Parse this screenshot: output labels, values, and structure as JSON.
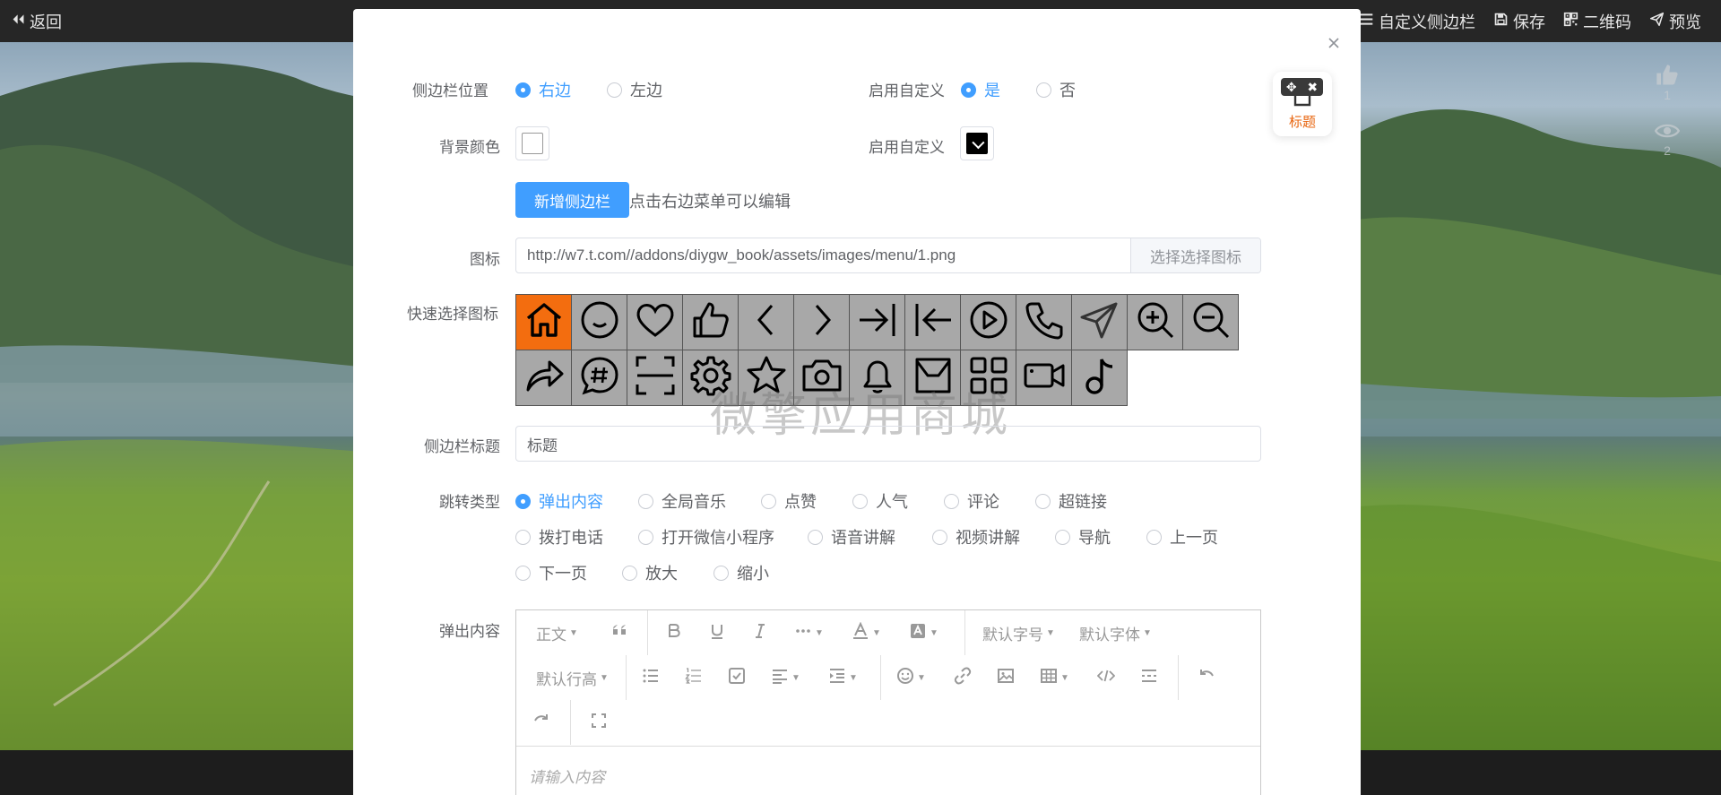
{
  "topbar": {
    "back_label": "返回",
    "actions": [
      {
        "icon": "list-icon",
        "label": "自定义侧边栏"
      },
      {
        "icon": "save-icon",
        "label": "保存"
      },
      {
        "icon": "qrcode-icon",
        "label": "二维码"
      },
      {
        "icon": "paper-plane-icon",
        "label": "预览"
      }
    ]
  },
  "background": {
    "stats": {
      "likes": "1",
      "views": "2"
    }
  },
  "modal": {
    "preview": {
      "label": "标题"
    },
    "sidebar_position": {
      "label": "侧边栏位置",
      "options": [
        "右边",
        "左边"
      ],
      "selected": "右边"
    },
    "enable_custom": {
      "label": "启用自定义",
      "options": [
        "是",
        "否"
      ],
      "selected": "是"
    },
    "bg_color": {
      "label": "背景颜色",
      "value": "#ffffff"
    },
    "enable_custom_color": {
      "label": "启用自定义",
      "value": "#000000"
    },
    "add_sidebar": {
      "button": "新增侧边栏",
      "hint": "点击右边菜单可以编辑"
    },
    "icon": {
      "label": "图标",
      "value": "http://w7.t.com//addons/diygw_book/assets/images/menu/1.png",
      "button": "选择选择图标"
    },
    "quick_icons": {
      "label": "快速选择图标",
      "selected": "home-icon",
      "icons": [
        "home-icon",
        "smile-icon",
        "heart-icon",
        "thumbs-up-icon",
        "chevron-left-icon",
        "chevron-right-icon",
        "arrow-right-bar-icon",
        "arrow-left-bar-icon",
        "play-circle-icon",
        "phone-icon",
        "paper-plane-icon",
        "zoom-in-icon",
        "zoom-out-icon",
        "share-arrow-icon",
        "hashtag-icon",
        "scan-icon",
        "settings-icon",
        "star-icon",
        "camera-icon",
        "bell-icon",
        "inbox-icon",
        "grid-icon",
        "video-icon",
        "music-note-icon"
      ]
    },
    "watermark": "微擎应用商城",
    "sidebar_title": {
      "label": "侧边栏标题",
      "value": "标题"
    },
    "jump_type": {
      "label": "跳转类型",
      "selected": "弹出内容",
      "options": [
        "弹出内容",
        "全局音乐",
        "点赞",
        "人气",
        "评论",
        "超链接",
        "拨打电话",
        "打开微信小程序",
        "语音讲解",
        "视频讲解",
        "导航",
        "上一页",
        "下一页",
        "放大",
        "缩小"
      ]
    },
    "popup_content": {
      "label": "弹出内容",
      "toolbar": {
        "paragraph": "正文",
        "font_size": "默认字号",
        "font_family": "默认字体",
        "line_height": "默认行高"
      },
      "placeholder": "请输入内容"
    }
  }
}
